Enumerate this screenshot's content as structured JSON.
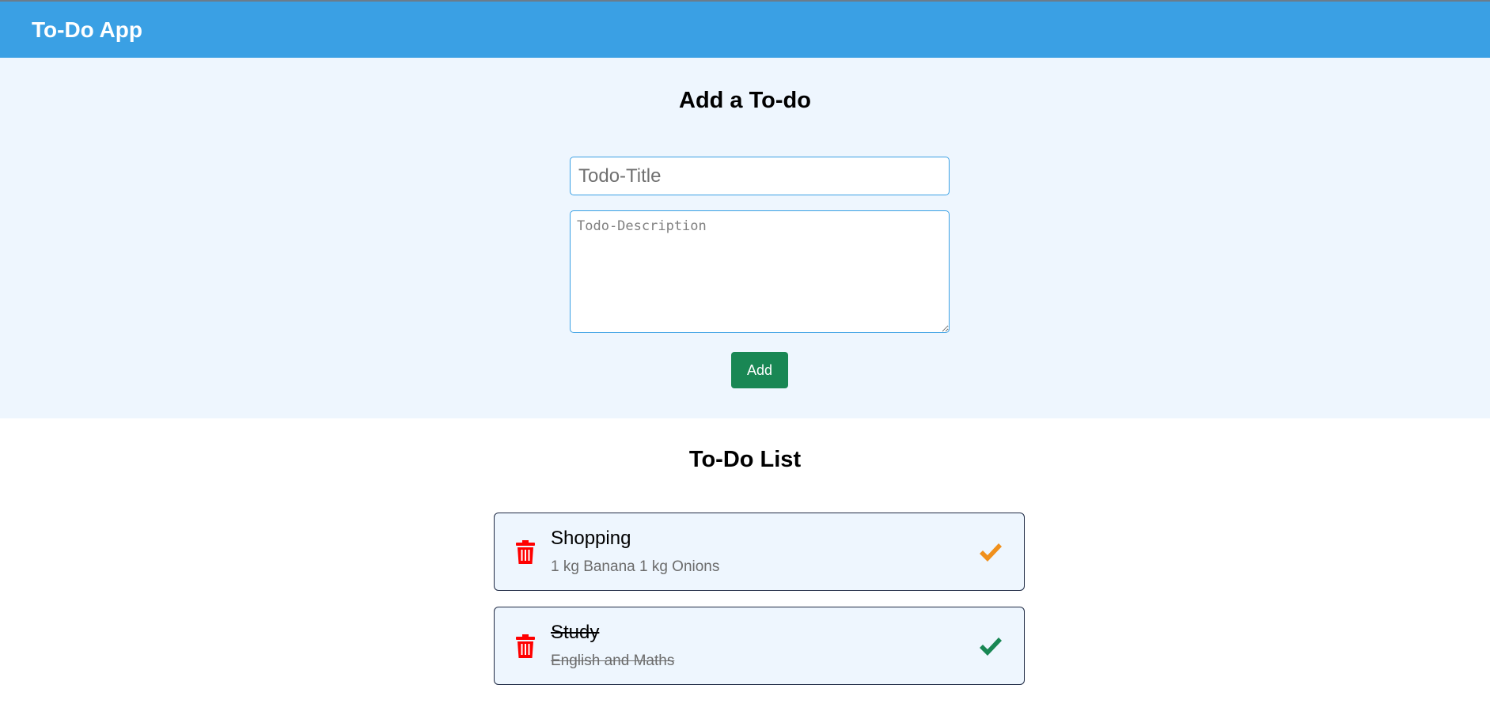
{
  "header": {
    "app_title": "To-Do App"
  },
  "add_form": {
    "heading": "Add a To-do",
    "title_placeholder": "Todo-Title",
    "title_value": "",
    "description_placeholder": "Todo-Description",
    "description_value": "",
    "add_label": "Add"
  },
  "list": {
    "heading": "To-Do List",
    "items": [
      {
        "title": "Shopping",
        "description": "1 kg Banana 1 kg Onions",
        "completed": false,
        "check_color": "#f0901c",
        "delete_icon": "trash-icon"
      },
      {
        "title": "Study",
        "description": "English and Maths",
        "completed": true,
        "check_color": "#198754",
        "delete_icon": "trash-icon"
      }
    ]
  },
  "colors": {
    "header_bg": "#3aa0e4",
    "section_bg": "#eef6fe",
    "add_button_bg": "#198754",
    "delete_icon": "#ff0000",
    "pending_check": "#f0901c",
    "done_check": "#198754"
  }
}
